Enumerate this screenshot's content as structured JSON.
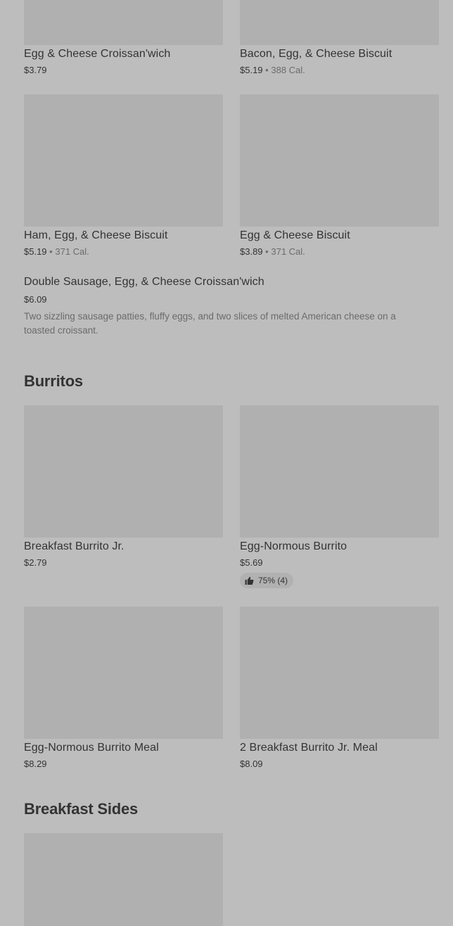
{
  "items": [
    {
      "name": "Egg & Cheese Croissan'wich",
      "price": "$3.79",
      "calories": ""
    },
    {
      "name": "Bacon, Egg, & Cheese Biscuit",
      "price": "$5.19",
      "calories": "388 Cal."
    },
    {
      "name": "Ham, Egg, & Cheese Biscuit",
      "price": "$5.19",
      "calories": "371 Cal."
    },
    {
      "name": "Egg & Cheese Biscuit",
      "price": "$3.89",
      "calories": "371 Cal."
    }
  ],
  "featured": {
    "name": "Double Sausage, Egg, & Cheese Croissan'wich",
    "price": "$6.09",
    "description": "Two sizzling sausage patties, fluffy eggs, and two slices of melted American cheese on a toasted croissant."
  },
  "separator": "•",
  "sections": {
    "burritos": {
      "title": "Burritos",
      "items": [
        {
          "name": "Breakfast Burrito Jr.",
          "price": "$2.79"
        },
        {
          "name": "Egg-Normous Burrito",
          "price": "$5.69",
          "rating": "75% (4)"
        },
        {
          "name": "Egg-Normous Burrito Meal",
          "price": "$8.29"
        },
        {
          "name": "2 Breakfast Burrito Jr. Meal",
          "price": "$8.09"
        }
      ]
    },
    "sides": {
      "title": "Breakfast Sides"
    }
  },
  "icons": {
    "rating": "thumbs-up-icon"
  },
  "colors": {
    "background": "#bdbdbd",
    "thumbnail": "#b0b0b0",
    "text": "#333333",
    "muted": "#6b6b6b"
  }
}
